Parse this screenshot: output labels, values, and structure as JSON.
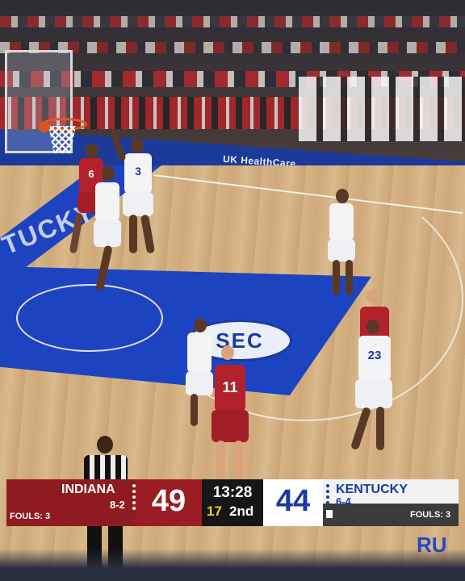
{
  "scene": {
    "sponsor_text": "UK HealthCare",
    "left_floor_text": "TUCKY",
    "right_floor_text": "RU",
    "center_logo_text": "SEC"
  },
  "players": {
    "home_jersey_number_foreground": "11",
    "home_jersey_number_jumper": "6",
    "away_jersey_number_shooter": "3",
    "away_jersey_number_defender": "23"
  },
  "scorebug": {
    "home": {
      "name": "INDIANA",
      "record": "8-2",
      "score": "49",
      "fouls_label": "FOULS: 3",
      "color": "#8e1b20"
    },
    "clock": {
      "time": "13:28",
      "shot_clock": "17",
      "period": "2nd"
    },
    "away": {
      "name": "KENTUCKY",
      "record": "6-4",
      "score": "44",
      "fouls_label": "FOULS: 3",
      "color": "#1b3aa0"
    }
  }
}
